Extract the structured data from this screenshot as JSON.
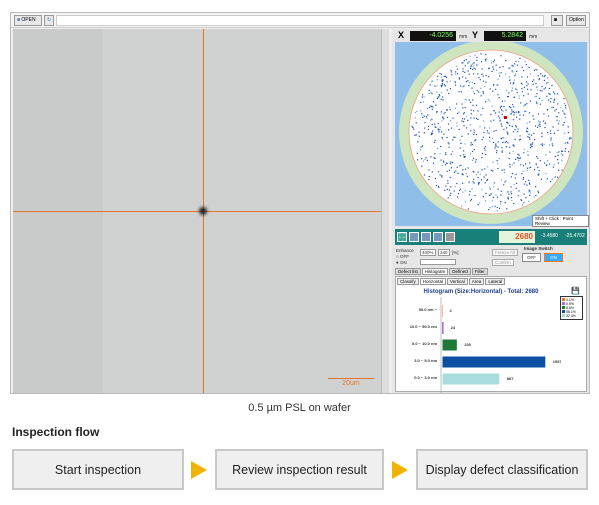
{
  "toolbar": {
    "open_label": "OPEN",
    "option_label": "Option"
  },
  "coords": {
    "x_label": "X",
    "x_value": "-4.0256",
    "y_label": "Y",
    "y_value": "5.2842",
    "unit": "mm"
  },
  "wafer_map": {
    "hint": "Shift + Click : Point Review",
    "background": "#8fbfe8",
    "ring": "#cfe5c0",
    "dot_color": "#1f4fbf"
  },
  "defect_count": "2680",
  "pos_x": "-3.4580",
  "pos_y": "-25.4702",
  "controls": {
    "enhance": "Enhance",
    "off": "OFF",
    "on": "ON",
    "zoom": "400%",
    "value": "340",
    "unit": "[%]",
    "freeze": "Freeze All",
    "confirm": "Confirm",
    "image_switch": "Image Switch",
    "off_btn": "OFF",
    "on_btn": "ON"
  },
  "tabs": [
    "Defect list",
    "Histogram",
    "Defined",
    "Filter"
  ],
  "subtabs": [
    "Classify",
    "Horizontal",
    "Vertical",
    "Area",
    "Lateral"
  ],
  "histogram": {
    "title": "Histogram (Size:Horizontal) - Total: 2680",
    "rows": [
      {
        "label": "50.0 nm ~",
        "value": 2,
        "color": "#f07a20",
        "pct": "0.1%"
      },
      {
        "label": "10.0 ~ 50.0 nm",
        "value": 24,
        "color": "#b070c0",
        "pct": "0.9%"
      },
      {
        "label": "5.0 ~ 10.0 nm",
        "value": 230,
        "color": "#1f7a3a",
        "pct": "8.6%"
      },
      {
        "label": "3.0 ~ 5.0 nm",
        "value": 1557,
        "color": "#0b4ea2",
        "pct": "58.1%"
      },
      {
        "label": "0.0 ~ 3.0 nm",
        "value": 867,
        "color": "#a9dcdc",
        "pct": "32.4%"
      }
    ],
    "max": 1800
  },
  "scale_bar": "20um",
  "crosshair_color": "#e8732a",
  "caption": "0.5 µm PSL on wafer",
  "flow": {
    "title": "Inspection flow",
    "steps": [
      "Start inspection",
      "Review inspection result",
      "Display defect classification"
    ],
    "arrow_color": "#f0b400"
  }
}
